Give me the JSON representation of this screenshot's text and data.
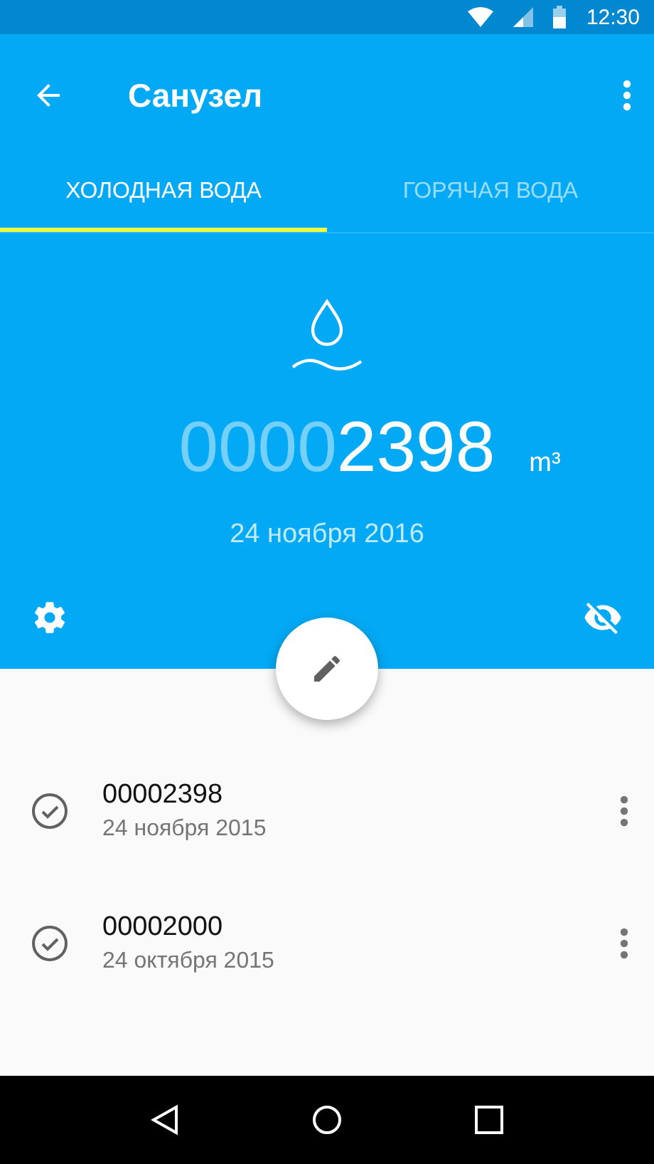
{
  "status_bar": {
    "time": "12:30"
  },
  "app_bar": {
    "title": "Санузел"
  },
  "tabs": [
    {
      "label": "ХОЛОДНАЯ ВОДА",
      "selected": true
    },
    {
      "label": "ГОРЯЧАЯ ВОДА",
      "selected": false
    }
  ],
  "meter": {
    "leading_zeros": "0000",
    "value": "2398",
    "unit": "m³",
    "date": "24 ноября 2016"
  },
  "readings": [
    {
      "value": "00002398",
      "date": "24 ноября 2015",
      "checked": true
    },
    {
      "value": "00002000",
      "date": "24 октября 2015",
      "checked": true
    }
  ]
}
